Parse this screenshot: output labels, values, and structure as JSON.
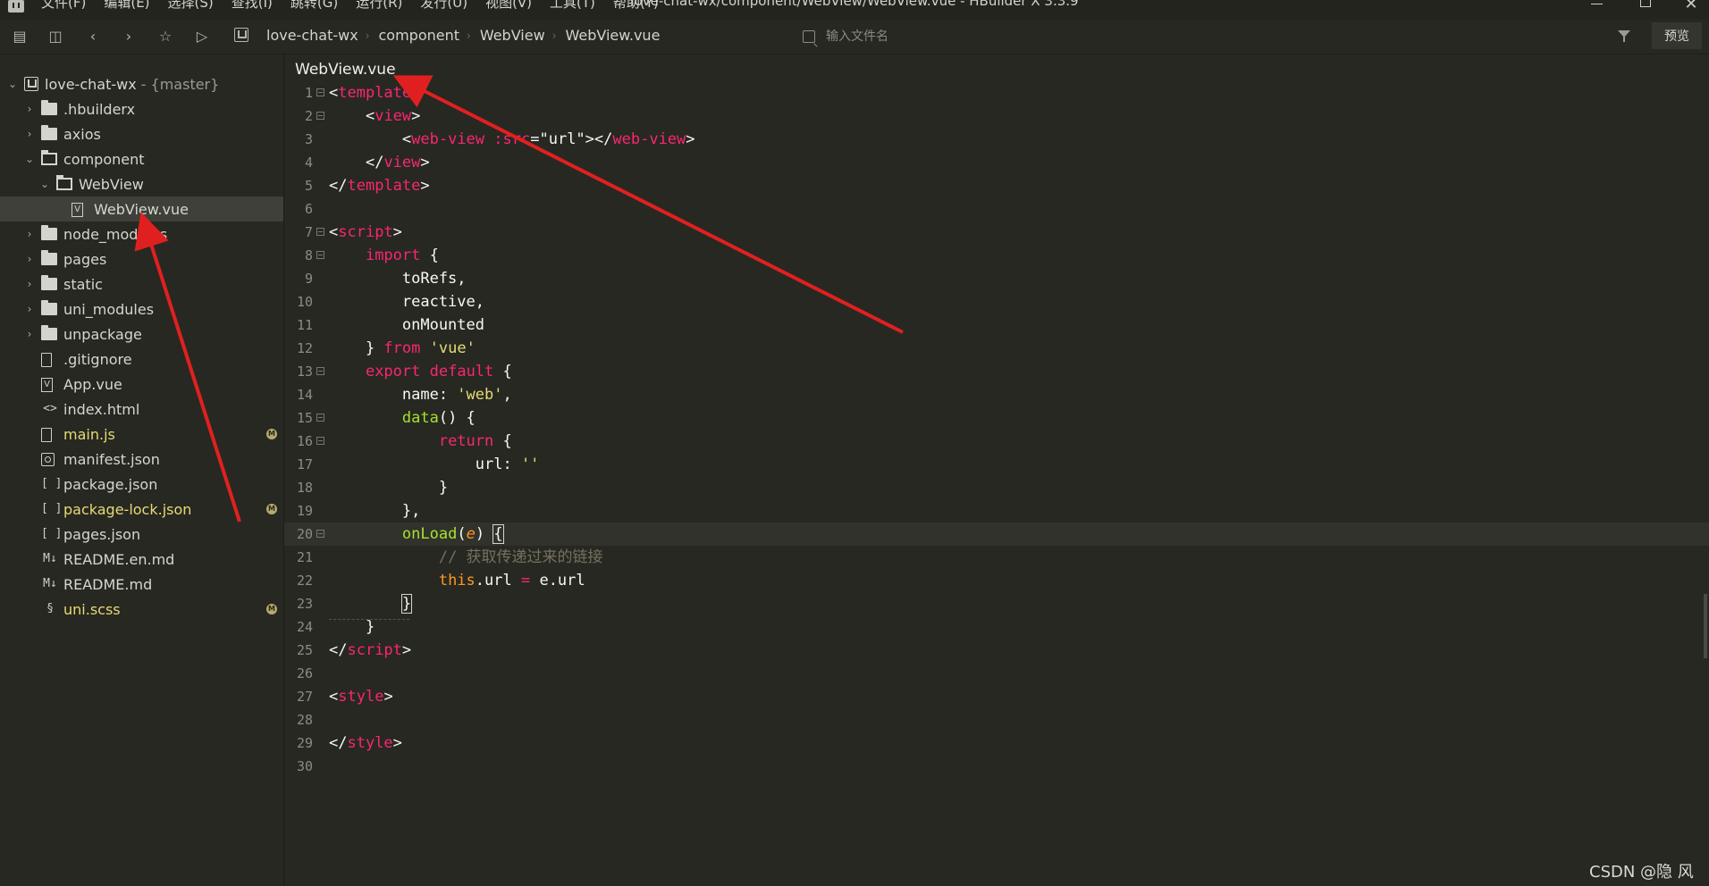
{
  "window": {
    "title": "love-chat-wx/component/WebView/WebView.vue - HBuilder X 3.3.9",
    "menu": [
      "文件(F)",
      "编辑(E)",
      "选择(S)",
      "查找(I)",
      "跳转(G)",
      "运行(R)",
      "发行(U)",
      "视图(V)",
      "工具(T)",
      "帮助(Y)"
    ],
    "controls": {
      "minimize": "—",
      "maximize": "□",
      "close": "✕"
    }
  },
  "toolbar": {
    "icons": [
      "save-all-icon",
      "save-icon",
      "back-icon",
      "forward-icon",
      "star-icon",
      "run-icon"
    ],
    "breadcrumb": [
      "love-chat-wx",
      "component",
      "WebView",
      "WebView.vue"
    ],
    "file_search_placeholder": "输入文件名",
    "preview_label": "预览"
  },
  "sidebar": {
    "project": {
      "name": "love-chat-wx",
      "branch": "- {master}"
    },
    "items": [
      {
        "label": ".hbuilderx",
        "type": "folder",
        "depth": 1,
        "expanded": false,
        "modified": false
      },
      {
        "label": "axios",
        "type": "folder",
        "depth": 1,
        "expanded": false,
        "modified": false
      },
      {
        "label": "component",
        "type": "folder",
        "depth": 1,
        "expanded": true,
        "modified": false
      },
      {
        "label": "WebView",
        "type": "folder",
        "depth": 2,
        "expanded": true,
        "modified": false
      },
      {
        "label": "WebView.vue",
        "type": "vue",
        "depth": 3,
        "expanded": false,
        "modified": false,
        "selected": true
      },
      {
        "label": "node_modules",
        "type": "folder",
        "depth": 1,
        "expanded": false,
        "modified": false
      },
      {
        "label": "pages",
        "type": "folder",
        "depth": 1,
        "expanded": false,
        "modified": false
      },
      {
        "label": "static",
        "type": "folder",
        "depth": 1,
        "expanded": false,
        "modified": false
      },
      {
        "label": "uni_modules",
        "type": "folder",
        "depth": 1,
        "expanded": false,
        "modified": false
      },
      {
        "label": "unpackage",
        "type": "folder",
        "depth": 1,
        "expanded": false,
        "modified": false
      },
      {
        "label": ".gitignore",
        "type": "file",
        "depth": 1,
        "expanded": false,
        "modified": false
      },
      {
        "label": "App.vue",
        "type": "vue",
        "depth": 1,
        "expanded": false,
        "modified": false
      },
      {
        "label": "index.html",
        "type": "html",
        "depth": 1,
        "expanded": false,
        "modified": false
      },
      {
        "label": "main.js",
        "type": "js",
        "depth": 1,
        "expanded": false,
        "modified": true
      },
      {
        "label": "manifest.json",
        "type": "manifest",
        "depth": 1,
        "expanded": false,
        "modified": false
      },
      {
        "label": "package.json",
        "type": "json",
        "depth": 1,
        "expanded": false,
        "modified": false
      },
      {
        "label": "package-lock.json",
        "type": "json",
        "depth": 1,
        "expanded": false,
        "modified": true
      },
      {
        "label": "pages.json",
        "type": "json",
        "depth": 1,
        "expanded": false,
        "modified": false
      },
      {
        "label": "README.en.md",
        "type": "md",
        "depth": 1,
        "expanded": false,
        "modified": false
      },
      {
        "label": "README.md",
        "type": "md",
        "depth": 1,
        "expanded": false,
        "modified": false
      },
      {
        "label": "uni.scss",
        "type": "scss",
        "depth": 1,
        "expanded": false,
        "modified": true
      }
    ],
    "modified_badge": "M"
  },
  "editor": {
    "tab_label": "WebView.vue",
    "current_line": 20,
    "lines": [
      {
        "n": "1",
        "fold": true,
        "tokens": [
          [
            "punc",
            "<"
          ],
          [
            "tag",
            "template"
          ],
          [
            "punc",
            ">"
          ]
        ]
      },
      {
        "n": "2",
        "fold": true,
        "tokens": [
          [
            "plain",
            "    "
          ],
          [
            "punc",
            "<"
          ],
          [
            "tag",
            "view"
          ],
          [
            "punc",
            ">"
          ]
        ]
      },
      {
        "n": "3",
        "fold": false,
        "tokens": [
          [
            "plain",
            "        "
          ],
          [
            "punc",
            "<"
          ],
          [
            "tag",
            "web-view"
          ],
          [
            "plain",
            " "
          ],
          [
            "attr",
            ":src"
          ],
          [
            "punc",
            "="
          ],
          [
            "plain",
            "\"url\""
          ],
          [
            "punc",
            "></"
          ],
          [
            "tag",
            "web-view"
          ],
          [
            "punc",
            ">"
          ]
        ]
      },
      {
        "n": "4",
        "fold": false,
        "tokens": [
          [
            "plain",
            "    "
          ],
          [
            "punc",
            "</"
          ],
          [
            "tag",
            "view"
          ],
          [
            "punc",
            ">"
          ]
        ]
      },
      {
        "n": "5",
        "fold": false,
        "tokens": [
          [
            "punc",
            "</"
          ],
          [
            "tag",
            "template"
          ],
          [
            "punc",
            ">"
          ]
        ]
      },
      {
        "n": "6",
        "fold": false,
        "tokens": []
      },
      {
        "n": "7",
        "fold": true,
        "tokens": [
          [
            "punc",
            "<"
          ],
          [
            "tag",
            "script"
          ],
          [
            "punc",
            ">"
          ]
        ]
      },
      {
        "n": "8",
        "fold": true,
        "tokens": [
          [
            "plain",
            "    "
          ],
          [
            "kw",
            "import"
          ],
          [
            "plain",
            " {"
          ]
        ]
      },
      {
        "n": "9",
        "fold": false,
        "tokens": [
          [
            "plain",
            "        toRefs,"
          ]
        ]
      },
      {
        "n": "10",
        "fold": false,
        "tokens": [
          [
            "plain",
            "        reactive,"
          ]
        ]
      },
      {
        "n": "11",
        "fold": false,
        "tokens": [
          [
            "plain",
            "        onMounted"
          ]
        ]
      },
      {
        "n": "12",
        "fold": false,
        "tokens": [
          [
            "plain",
            "    } "
          ],
          [
            "kw",
            "from"
          ],
          [
            "plain",
            " "
          ],
          [
            "str",
            "'vue'"
          ]
        ]
      },
      {
        "n": "13",
        "fold": true,
        "tokens": [
          [
            "plain",
            "    "
          ],
          [
            "kw",
            "export"
          ],
          [
            "plain",
            " "
          ],
          [
            "kw",
            "default"
          ],
          [
            "plain",
            " {"
          ]
        ]
      },
      {
        "n": "14",
        "fold": false,
        "tokens": [
          [
            "plain",
            "        name: "
          ],
          [
            "str",
            "'web'"
          ],
          [
            "plain",
            ","
          ]
        ]
      },
      {
        "n": "15",
        "fold": true,
        "tokens": [
          [
            "plain",
            "        "
          ],
          [
            "fn",
            "data"
          ],
          [
            "plain",
            "() {"
          ]
        ]
      },
      {
        "n": "16",
        "fold": true,
        "tokens": [
          [
            "plain",
            "            "
          ],
          [
            "kw",
            "return"
          ],
          [
            "plain",
            " {"
          ]
        ]
      },
      {
        "n": "17",
        "fold": false,
        "tokens": [
          [
            "plain",
            "                url: "
          ],
          [
            "str",
            "''"
          ]
        ]
      },
      {
        "n": "18",
        "fold": false,
        "tokens": [
          [
            "plain",
            "            }"
          ]
        ]
      },
      {
        "n": "19",
        "fold": false,
        "tokens": [
          [
            "plain",
            "        },"
          ]
        ]
      },
      {
        "n": "20",
        "fold": true,
        "tokens": [
          [
            "plain",
            "        "
          ],
          [
            "fn",
            "onLoad"
          ],
          [
            "plain",
            "("
          ],
          [
            "param",
            "e"
          ],
          [
            "plain",
            ") "
          ],
          [
            "cursor",
            "{"
          ]
        ]
      },
      {
        "n": "21",
        "fold": false,
        "tokens": [
          [
            "plain",
            "            "
          ],
          [
            "cmt",
            "// 获取传递过来的链接"
          ]
        ]
      },
      {
        "n": "22",
        "fold": false,
        "tokens": [
          [
            "plain",
            "            "
          ],
          [
            "this",
            "this"
          ],
          [
            "plain",
            ".url "
          ],
          [
            "kw",
            "="
          ],
          [
            "plain",
            " e.url"
          ]
        ]
      },
      {
        "n": "23",
        "fold": false,
        "tokens": [
          [
            "plain",
            "        "
          ],
          [
            "cursor",
            "}"
          ]
        ]
      },
      {
        "n": "24",
        "fold": false,
        "tokens": [
          [
            "plain",
            "    }"
          ]
        ]
      },
      {
        "n": "25",
        "fold": false,
        "tokens": [
          [
            "punc",
            "</"
          ],
          [
            "tag",
            "script"
          ],
          [
            "punc",
            ">"
          ]
        ]
      },
      {
        "n": "26",
        "fold": false,
        "tokens": []
      },
      {
        "n": "27",
        "fold": false,
        "tokens": [
          [
            "punc",
            "<"
          ],
          [
            "tag",
            "style"
          ],
          [
            "punc",
            ">"
          ]
        ]
      },
      {
        "n": "28",
        "fold": false,
        "tokens": []
      },
      {
        "n": "29",
        "fold": false,
        "tokens": [
          [
            "punc",
            "</"
          ],
          [
            "tag",
            "style"
          ],
          [
            "punc",
            ">"
          ]
        ]
      },
      {
        "n": "30",
        "fold": false,
        "tokens": []
      }
    ]
  },
  "annotations": {
    "arrow_color": "#e02020"
  },
  "watermark": "CSDN @隐 风"
}
